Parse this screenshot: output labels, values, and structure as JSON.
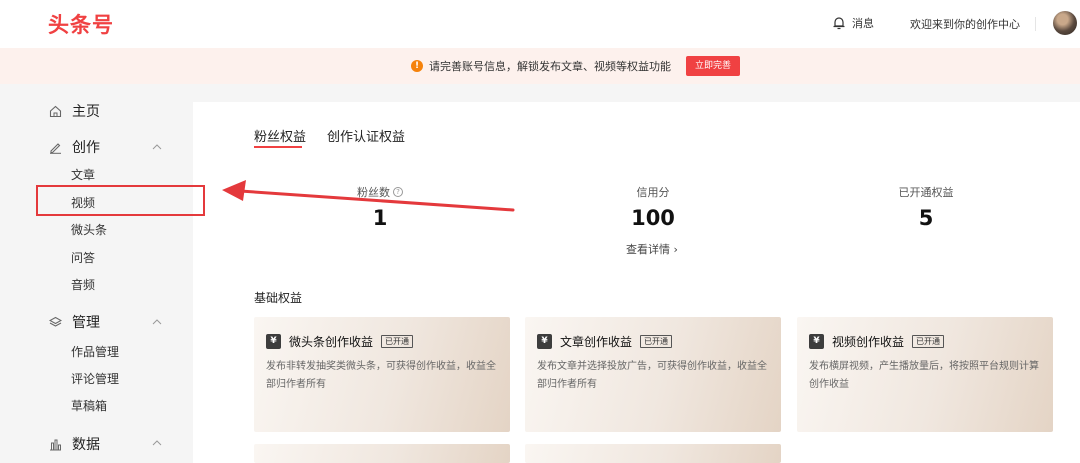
{
  "header": {
    "logo": "头条号",
    "messages_label": "消息",
    "welcome": "欢迎来到你的创作中心"
  },
  "notice": {
    "icon": "!",
    "text": "请完善账号信息，解锁发布文章、视频等权益功能",
    "button": "立即完善"
  },
  "sidebar": {
    "home": "主页",
    "create": {
      "label": "创作",
      "items": [
        "文章",
        "视频",
        "微头条",
        "问答",
        "音频"
      ]
    },
    "manage": {
      "label": "管理",
      "items": [
        "作品管理",
        "评论管理",
        "草稿箱"
      ]
    },
    "data": {
      "label": "数据"
    }
  },
  "tabs": [
    "粉丝权益",
    "创作认证权益"
  ],
  "stats": [
    {
      "label": "粉丝数",
      "value": "1"
    },
    {
      "label": "信用分",
      "value": "100"
    },
    {
      "label": "已开通权益",
      "value": "5"
    }
  ],
  "detail_link": "查看详情 ›",
  "section_title": "基础权益",
  "cards": [
    {
      "icon": "¥",
      "title": "微头条创作收益",
      "badge": "已开通",
      "desc": "发布非转发抽奖类微头条，可获得创作收益，收益全部归作者所有"
    },
    {
      "icon": "¥",
      "title": "文章创作收益",
      "badge": "已开通",
      "desc": "发布文章并选择投放广告，可获得创作收益，收益全部归作者所有"
    },
    {
      "icon": "¥",
      "title": "视频创作收益",
      "badge": "已开通",
      "desc": "发布横屏视频，产生播放量后，将按照平台规则计算创作收益"
    }
  ],
  "colors": {
    "brand": "#f04142",
    "annotation": "#e4393c"
  }
}
